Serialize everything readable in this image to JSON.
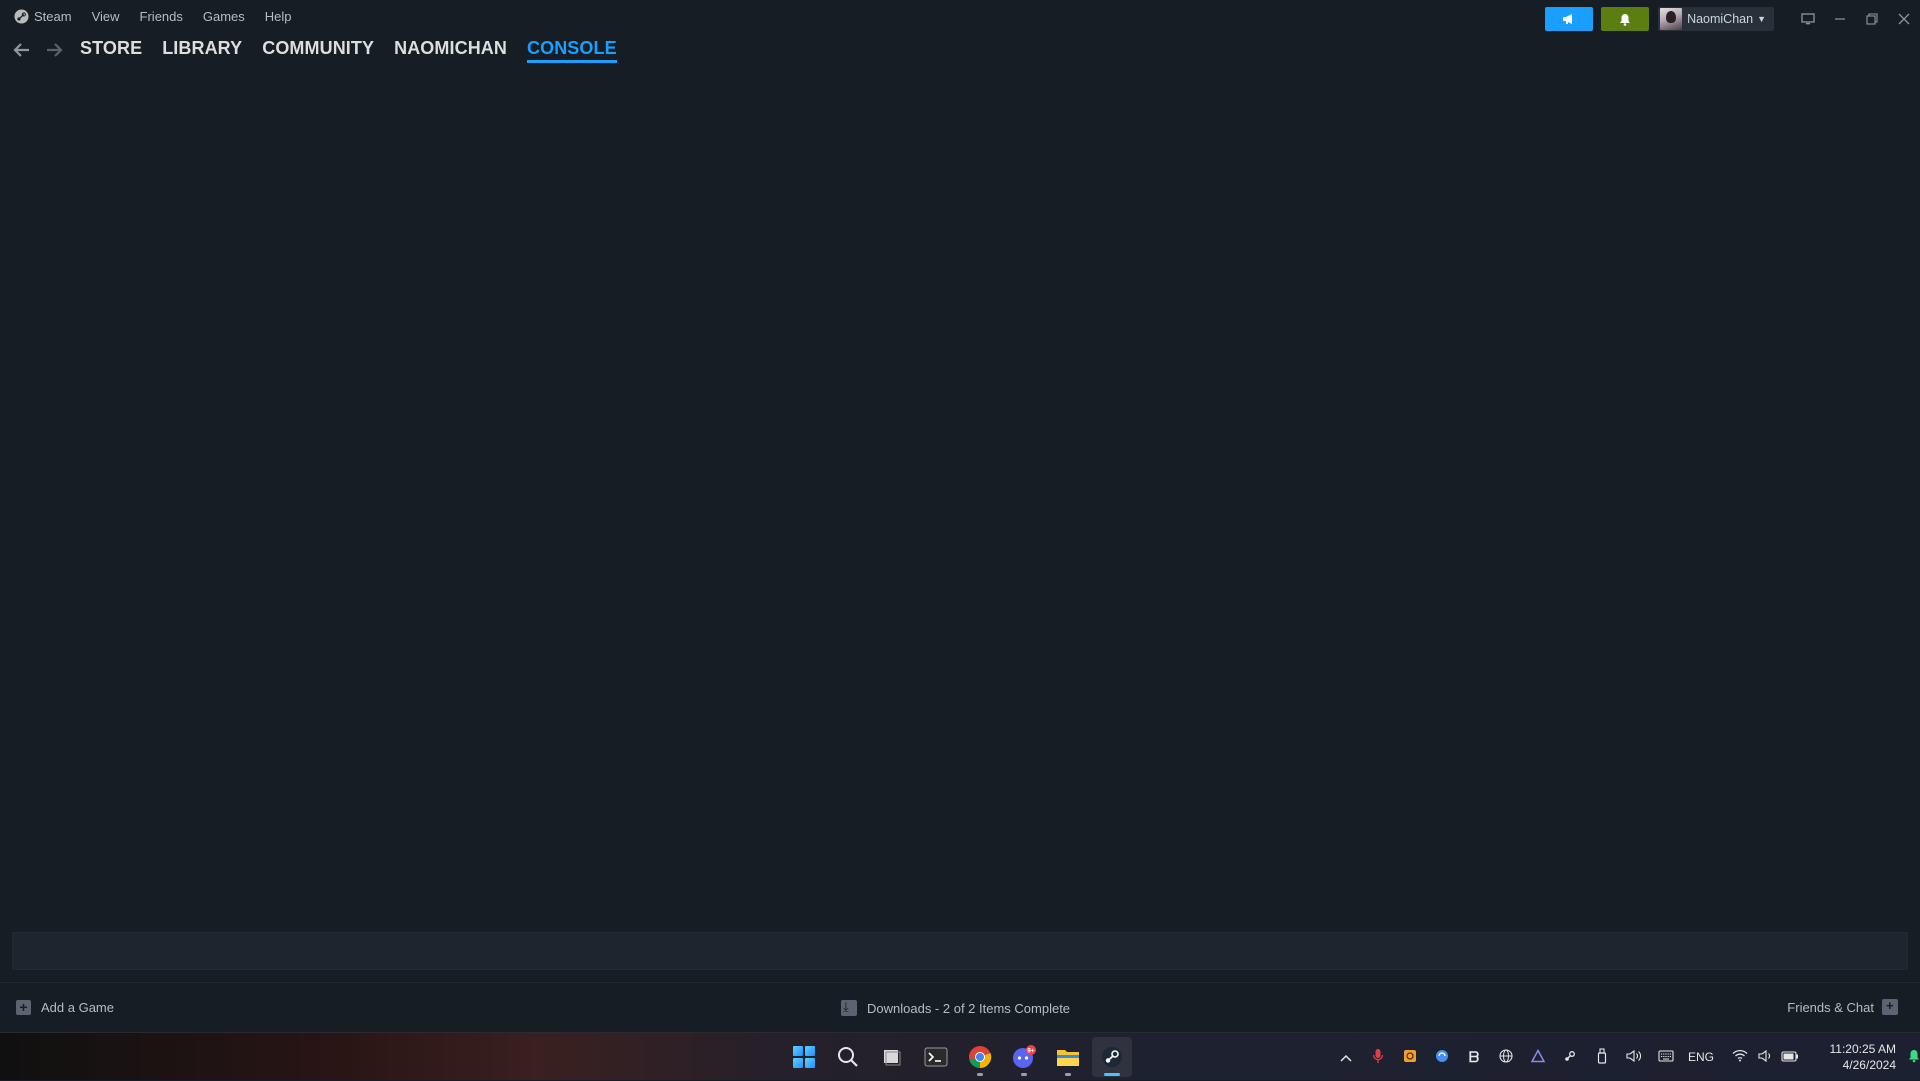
{
  "menu": {
    "items": [
      "Steam",
      "View",
      "Friends",
      "Games",
      "Help"
    ]
  },
  "account": {
    "name": "NaomiChan",
    "announce_color": "#1a9fff",
    "notify_color": "#5c7e10"
  },
  "nav": {
    "tabs": [
      "STORE",
      "LIBRARY",
      "COMMUNITY",
      "NAOMICHAN",
      "CONSOLE"
    ],
    "active_tab": "CONSOLE"
  },
  "console": {
    "input_value": ""
  },
  "footer": {
    "add_game": "Add a Game",
    "downloads": "Downloads - 2 of 2 Items Complete",
    "friends_chat": "Friends & Chat"
  },
  "taskbar": {
    "apps": [
      "start-icon",
      "search-icon",
      "task-view-icon",
      "terminal-icon",
      "chrome-icon",
      "discord-icon",
      "file-explorer-icon",
      "steam-icon"
    ],
    "discord_badge": "9+",
    "language": "ENG",
    "time": "11:20:25 AM",
    "date": "4/26/2024"
  },
  "colors": {
    "background": "#171d25",
    "accent": "#1a9fff"
  }
}
